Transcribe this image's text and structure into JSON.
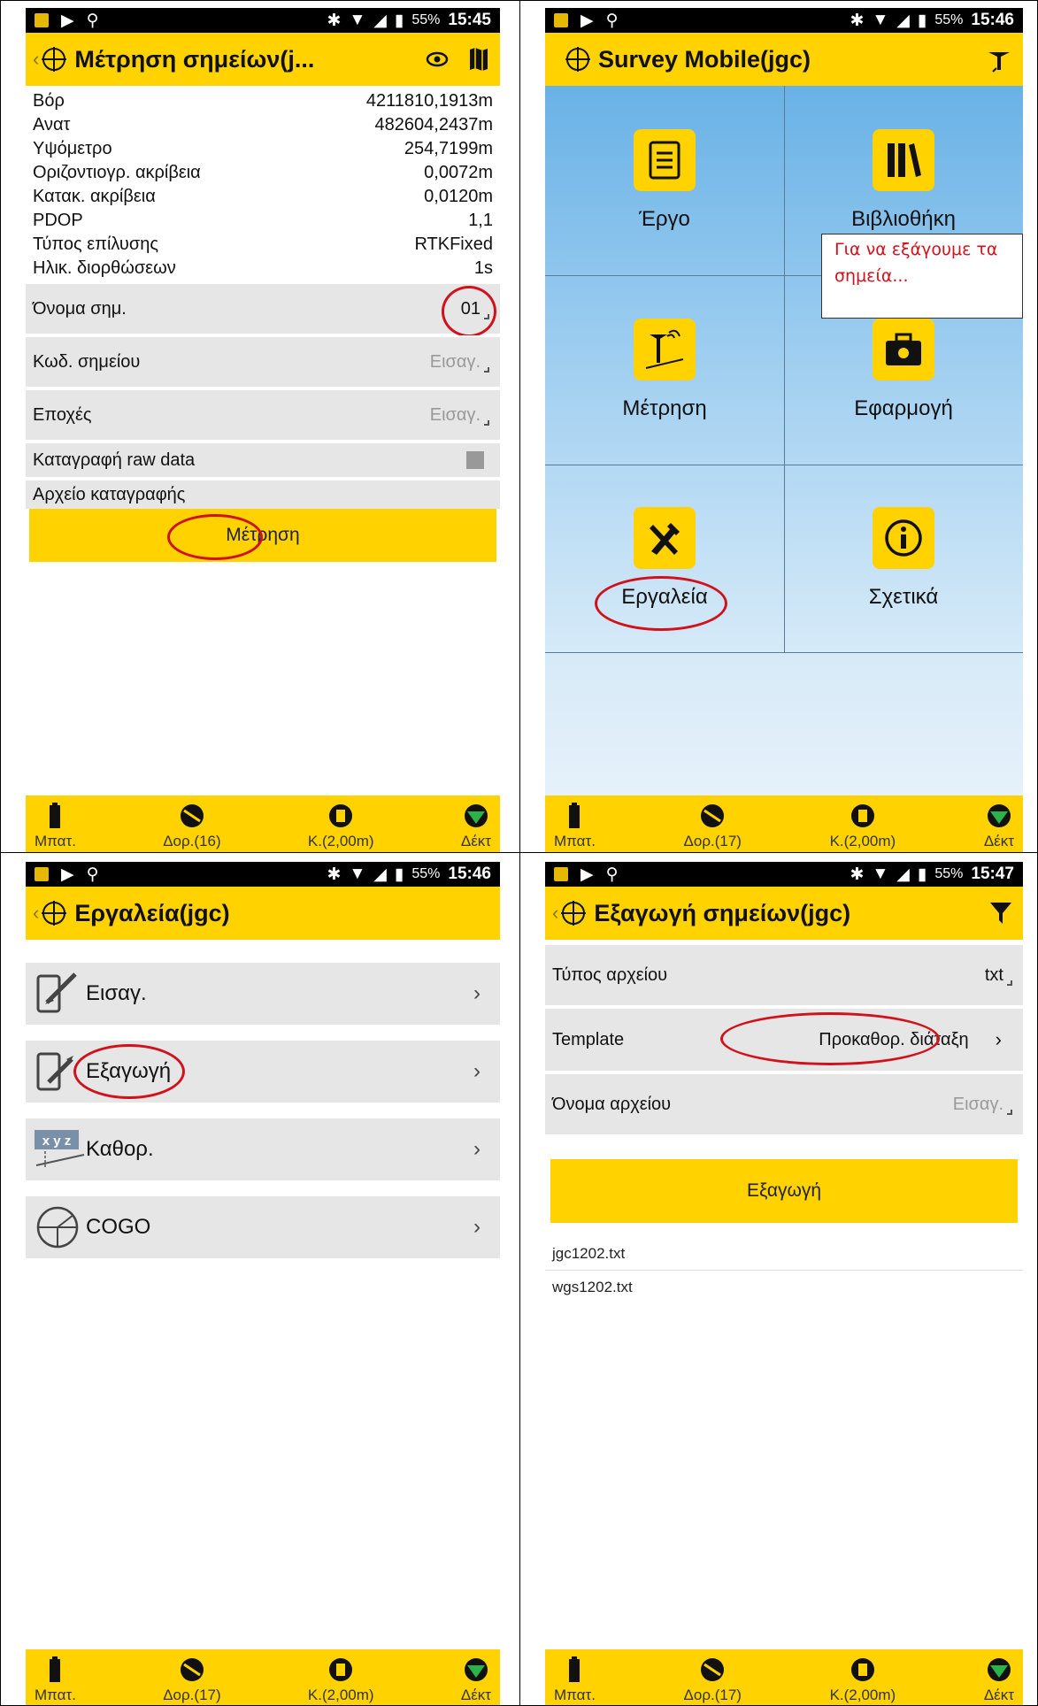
{
  "status": {
    "battery": "55%"
  },
  "bottombar": {
    "battery": "Μπατ.",
    "sats1": "Δορ.(16)",
    "sats2": "Δορ.(17)",
    "rod": "K.(2,00m)",
    "receiver": "Δέκτ"
  },
  "screen1": {
    "time": "15:45",
    "title": "Μέτρηση σημείων(j...",
    "rows": [
      {
        "label": "Βόρ",
        "value": "4211810,1913m"
      },
      {
        "label": "Ανατ",
        "value": "482604,2437m"
      },
      {
        "label": "Υψόμετρο",
        "value": "254,7199m"
      },
      {
        "label": "Οριζοντιογρ. ακρίβεια",
        "value": "0,0072m"
      },
      {
        "label": "Κατακ. ακρίβεια",
        "value": "0,0120m"
      },
      {
        "label": "PDOP",
        "value": "1,1"
      },
      {
        "label": "Τύπος επίλυσης",
        "value": "RTKFixed"
      },
      {
        "label": "Ηλικ. διορθώσεων",
        "value": "1s"
      }
    ],
    "point_name_label": "Όνομα σημ.",
    "point_name_value": "01",
    "point_code_label": "Κωδ. σημείου",
    "point_code_placeholder": "Εισαγ.",
    "epochs_label": "Εποχές",
    "epochs_placeholder": "Εισαγ.",
    "raw_label": "Καταγραφή raw data",
    "logfile_label": "Αρχείο καταγραφής",
    "measure_button": "Μέτρηση"
  },
  "screen2": {
    "time": "15:46",
    "title": "Survey Mobile(jgc)",
    "tiles": [
      "Έργο",
      "Βιβλιοθήκη",
      "Μέτρηση",
      "Εφαρμογή",
      "Εργαλεία",
      "Σχετικά"
    ],
    "callout": [
      "Για να εξάγουμε τα",
      "σημεία..."
    ]
  },
  "screen3": {
    "time": "15:46",
    "title": "Εργαλεία(jgc)",
    "items": [
      "Εισαγ.",
      "Εξαγωγή",
      "Καθορ.",
      "COGO"
    ],
    "chevron": "›"
  },
  "screen4": {
    "time": "15:47",
    "title": "Εξαγωγή σημείων(jgc)",
    "file_type_label": "Τύπος αρχείου",
    "file_type_value": "txt",
    "template_label": "Template",
    "template_value": "Προκαθορ. διάταξη",
    "filename_label": "Όνομα αρχείου",
    "filename_placeholder": "Εισαγ.",
    "export_button": "Εξαγωγή",
    "files": [
      "jgc1202.txt",
      "wgs1202.txt"
    ]
  }
}
